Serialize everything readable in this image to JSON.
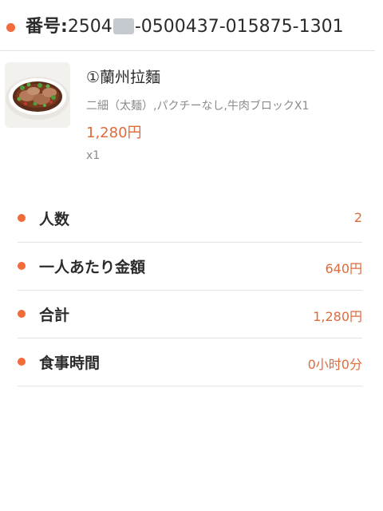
{
  "order": {
    "label": "番号:",
    "number_prefix": "2504",
    "number_suffix": "-0500437-015875-1301"
  },
  "item": {
    "image_icon": "ramen-bowl-photo",
    "name": "①蘭州拉麵",
    "options": "二細（太麺）,パクチーなし,牛肉ブロックX1",
    "price": "1,280円",
    "quantity": "x1"
  },
  "summary": [
    {
      "label": "人数",
      "value": "2"
    },
    {
      "label": "一人あたり金額",
      "value": "640円"
    },
    {
      "label": "合計",
      "value": "1,280円"
    },
    {
      "label": "食事時間",
      "value": "0小时0分"
    }
  ],
  "colors": {
    "accent": "#f26b3a",
    "price": "#e06a3b",
    "text": "#2b2b2b",
    "muted": "#8a8a8a",
    "divider": "#e3e3e3"
  }
}
